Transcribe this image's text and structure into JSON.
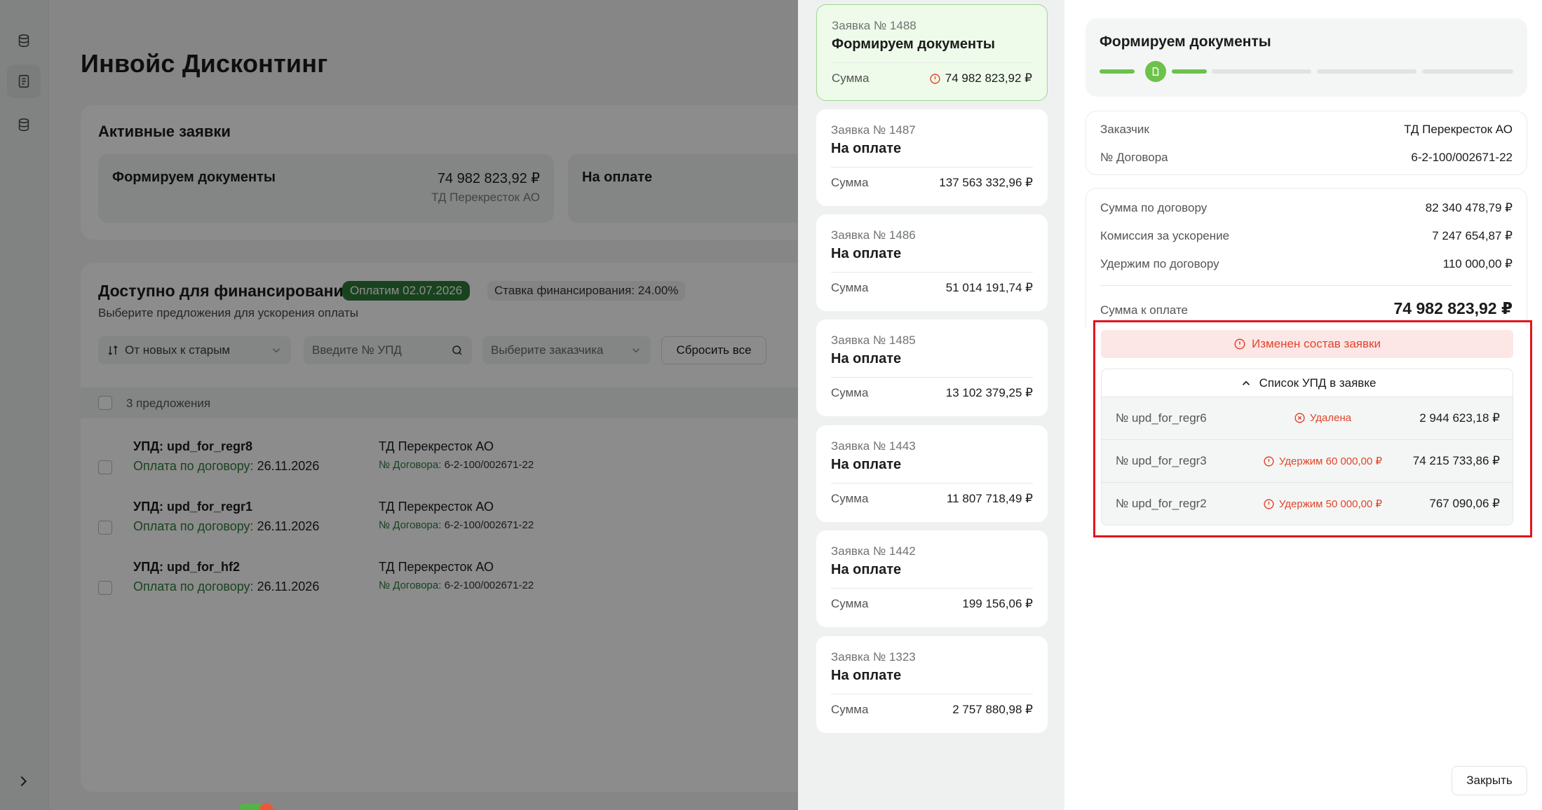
{
  "app": {
    "title": "Инвойс Дисконтинг",
    "active": {
      "title": "Активные заявки",
      "cards": [
        {
          "status": "Формируем документы",
          "amount": "74 982 823,92 ₽",
          "client": "ТД Перекресток АО"
        },
        {
          "status": "На оплате"
        }
      ]
    },
    "financing": {
      "title": "Доступно для финансирования",
      "pay_badge": "Оплатим 02.07.2026",
      "rate_badge": "Ставка финансирования: 24.00%",
      "subtitle": "Выберите предложения для ускорения оплаты",
      "sort_label": "От новых к старым",
      "search_placeholder": "Введите  № УПД",
      "client_placeholder": "Выберите заказчика",
      "reset_label": "Сбросить все",
      "count": "3 предложения",
      "offers": [
        {
          "upd": "УПД: upd_for_regr8",
          "pay_label": "Оплата по договору:",
          "pay_date": "26.11.2026",
          "client": "ТД Перекресток АО",
          "dog_label": "№ Договора:",
          "dog": "6-2-100/002671-22"
        },
        {
          "upd": "УПД: upd_for_regr1",
          "pay_label": "Оплата по договору:",
          "pay_date": "26.11.2026",
          "client": "ТД Перекресток АО",
          "dog_label": "№ Договора:",
          "dog": "6-2-100/002671-22"
        },
        {
          "upd": "УПД: upd_for_hf2",
          "pay_label": "Оплата по договору:",
          "pay_date": "26.11.2026",
          "client": "ТД Перекресток АО",
          "dog_label": "№ Договора:",
          "dog": "6-2-100/002671-22"
        }
      ]
    }
  },
  "requests": [
    {
      "num": "Заявка № 1488",
      "status": "Формируем документы",
      "sum_label": "Сумма",
      "sum": "74 982 823,92 ₽",
      "selected": true
    },
    {
      "num": "Заявка № 1487",
      "status": "На оплате",
      "sum_label": "Сумма",
      "sum": "137 563 332,96 ₽"
    },
    {
      "num": "Заявка № 1486",
      "status": "На оплате",
      "sum_label": "Сумма",
      "sum": "51 014 191,74 ₽"
    },
    {
      "num": "Заявка № 1485",
      "status": "На оплате",
      "sum_label": "Сумма",
      "sum": "13 102 379,25 ₽"
    },
    {
      "num": "Заявка № 1443",
      "status": "На оплате",
      "sum_label": "Сумма",
      "sum": "11 807 718,49 ₽"
    },
    {
      "num": "Заявка № 1442",
      "status": "На оплате",
      "sum_label": "Сумма",
      "sum": "199 156,06 ₽"
    },
    {
      "num": "Заявка № 1323",
      "status": "На оплате",
      "sum_label": "Сумма",
      "sum": "2 757 880,98 ₽"
    }
  ],
  "detail": {
    "title": "Формируем документы",
    "progress_step": 1,
    "progress_total": 5,
    "customer_label": "Заказчик",
    "customer": "ТД Перекресток АО",
    "contract_label": "№ Договора",
    "contract": "6-2-100/002671-22",
    "sum_contract_label": "Сумма по договору",
    "sum_contract": "82 340 478,79 ₽",
    "commission_label": "Комиссия за ускорение",
    "commission": "7 247 654,87 ₽",
    "hold_label": "Удержим по договору",
    "hold": "110 000,00 ₽",
    "to_pay_label": "Сумма к оплате",
    "to_pay": "74 982 823,92 ₽",
    "alert": "Изменен состав заявки",
    "upd_list_title": "Список УПД в заявке",
    "upd_rows": [
      {
        "num": "№ upd_for_regr6",
        "status": "Удалена",
        "amount": "2 944 623,18 ₽",
        "icon": "x-circle-icon"
      },
      {
        "num": "№ upd_for_regr3",
        "status": "Удержим 60 000,00 ₽",
        "amount": "74 215 733,86 ₽",
        "icon": "warning-icon"
      },
      {
        "num": "№ upd_for_regr2",
        "status": "Удержим 50 000,00 ₽",
        "amount": "767 090,06 ₽",
        "icon": "warning-icon"
      }
    ],
    "close_label": "Закрыть"
  },
  "colors": {
    "accent_green": "#6cc24a",
    "brand_green": "#2f7a3a",
    "alert_red": "#e0452a",
    "highlight_red": "#e3141d"
  }
}
